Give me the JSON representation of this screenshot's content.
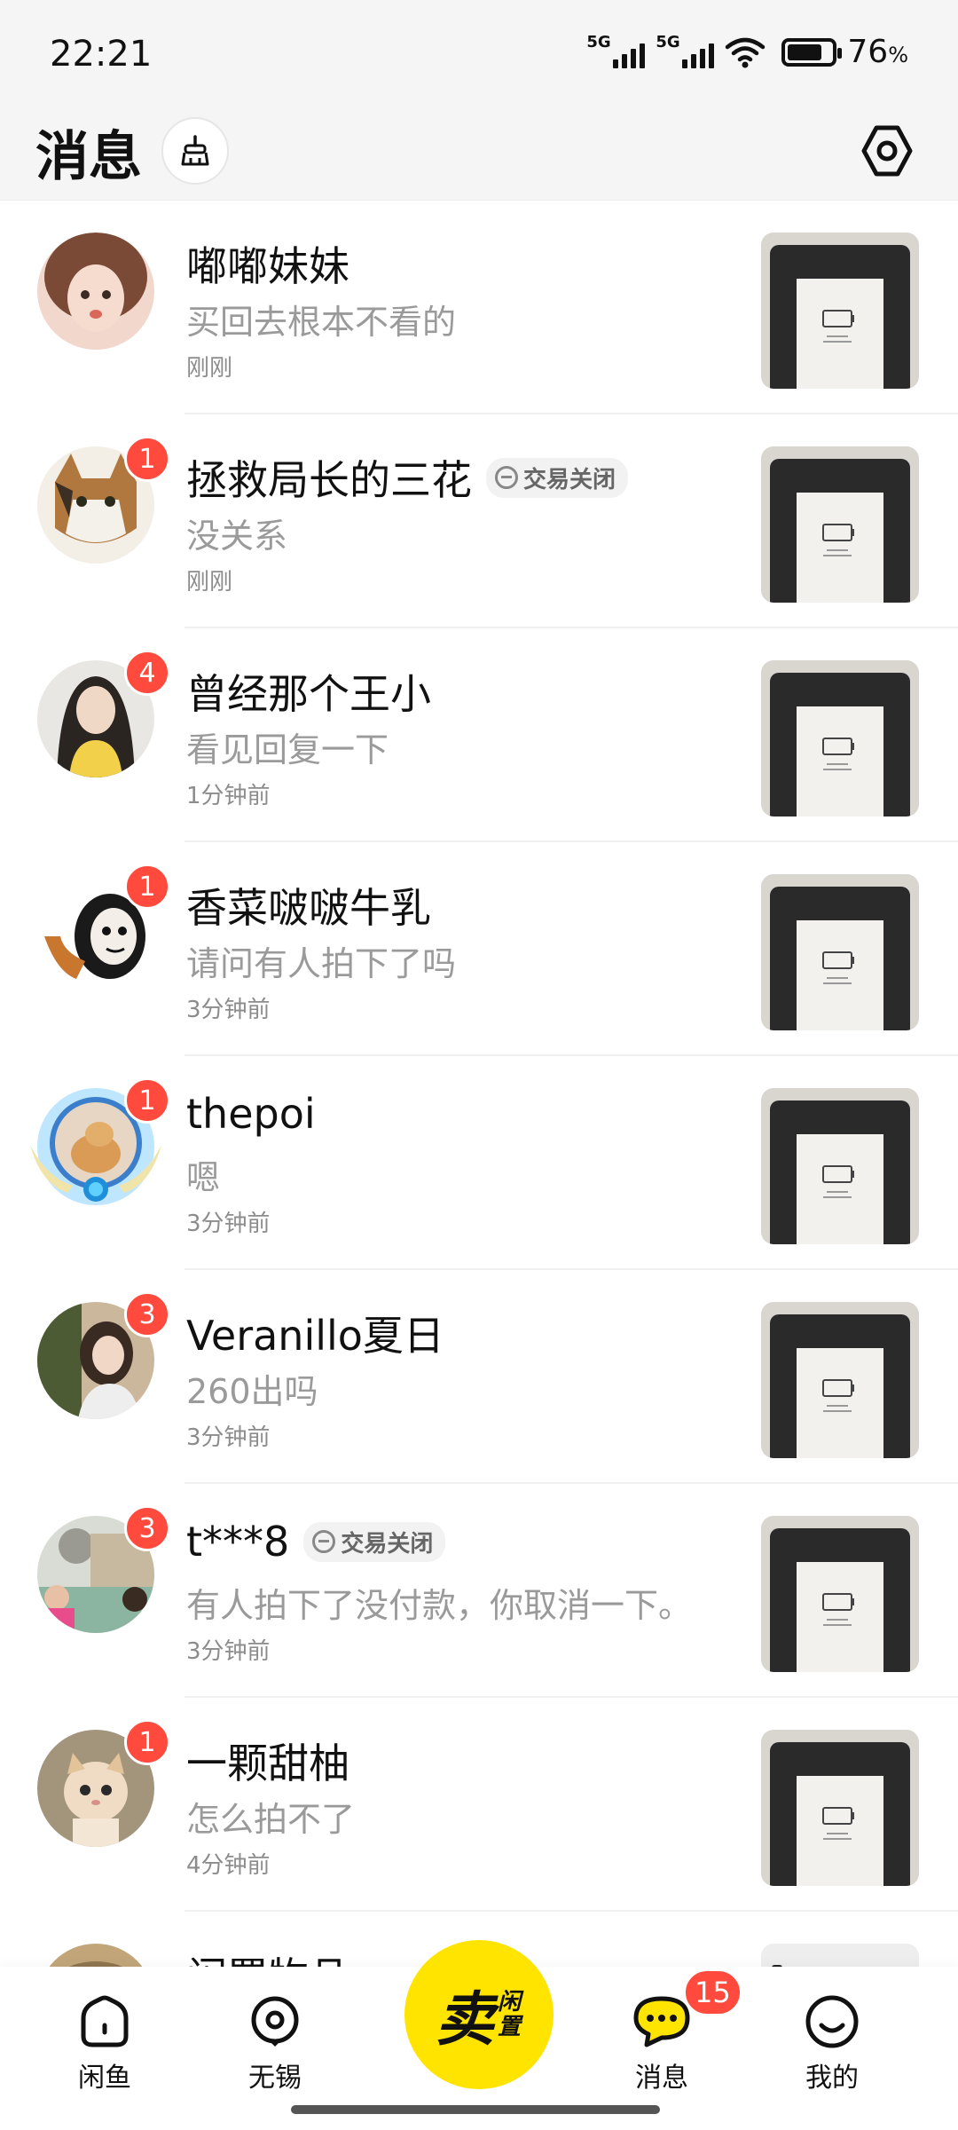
{
  "status_bar": {
    "time": "22:21",
    "network_1": "5G",
    "network_2": "5G",
    "battery_percent": "76",
    "battery_unit": "%",
    "battery_level": 0.76
  },
  "header": {
    "title": "消息",
    "clean_icon": "broom-icon",
    "settings_icon": "settings-hex-icon"
  },
  "conversations": [
    {
      "name": "嘟嘟妹妹",
      "preview": "买回去根本不看的",
      "time": "刚刚",
      "unread": "",
      "tag": "",
      "avatar_color": "#c98c7a"
    },
    {
      "name": "拯救局长的三花",
      "preview": "没关系",
      "time": "刚刚",
      "unread": "1",
      "tag": "交易关闭",
      "avatar_color": "#8a5a36"
    },
    {
      "name": "曾经那个王小",
      "preview": "看见回复一下",
      "time": "1分钟前",
      "unread": "4",
      "tag": "",
      "avatar_color": "#3a3a3a"
    },
    {
      "name": "香菜啵啵牛乳",
      "preview": "请问有人拍下了吗",
      "time": "3分钟前",
      "unread": "1",
      "tag": "",
      "avatar_color": "#222222"
    },
    {
      "name": "thepoi",
      "preview": "嗯",
      "time": "3分钟前",
      "unread": "1",
      "tag": "",
      "avatar_color": "#d9a56a"
    },
    {
      "name": "Veranillo夏日",
      "preview": "260出吗",
      "time": "3分钟前",
      "unread": "3",
      "tag": "",
      "avatar_color": "#7a6150"
    },
    {
      "name": "t***8",
      "preview": "有人拍下了没付款，你取消一下。",
      "time": "3分钟前",
      "unread": "3",
      "tag": "交易关闭",
      "avatar_color": "#9aa39b"
    },
    {
      "name": "一颗甜柚",
      "preview": "怎么拍不了",
      "time": "4分钟前",
      "unread": "1",
      "tag": "",
      "avatar_color": "#b89a78"
    },
    {
      "name": "闲置物品",
      "preview": "",
      "time": "",
      "unread": "",
      "tag": "",
      "avatar_color": "#c2a67a"
    }
  ],
  "bottom_nav": {
    "items": [
      {
        "label": "闲鱼",
        "icon": "home-icon"
      },
      {
        "label": "无锡",
        "icon": "location-icon"
      },
      {
        "label": "消息",
        "icon": "message-icon"
      },
      {
        "label": "我的",
        "icon": "profile-icon"
      }
    ],
    "sell": {
      "main": "卖",
      "sub": "闲置"
    },
    "message_badge": "15"
  },
  "colors": {
    "accent_yellow": "#ffe400",
    "badge_red": "#ff4a3d"
  }
}
